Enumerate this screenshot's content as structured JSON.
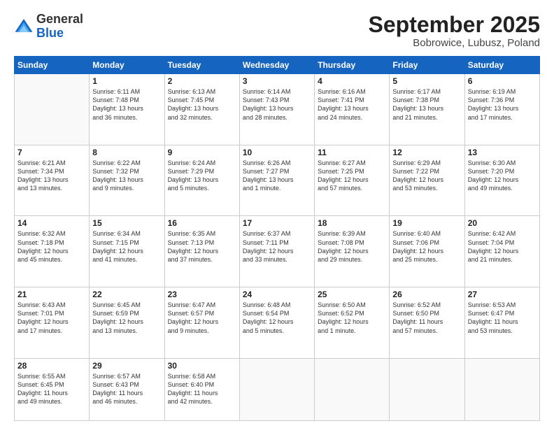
{
  "header": {
    "logo": {
      "general": "General",
      "blue": "Blue"
    },
    "title": "September 2025",
    "location": "Bobrowice, Lubusz, Poland"
  },
  "weekdays": [
    "Sunday",
    "Monday",
    "Tuesday",
    "Wednesday",
    "Thursday",
    "Friday",
    "Saturday"
  ],
  "weeks": [
    [
      {
        "day": "",
        "info": ""
      },
      {
        "day": "1",
        "info": "Sunrise: 6:11 AM\nSunset: 7:48 PM\nDaylight: 13 hours\nand 36 minutes."
      },
      {
        "day": "2",
        "info": "Sunrise: 6:13 AM\nSunset: 7:45 PM\nDaylight: 13 hours\nand 32 minutes."
      },
      {
        "day": "3",
        "info": "Sunrise: 6:14 AM\nSunset: 7:43 PM\nDaylight: 13 hours\nand 28 minutes."
      },
      {
        "day": "4",
        "info": "Sunrise: 6:16 AM\nSunset: 7:41 PM\nDaylight: 13 hours\nand 24 minutes."
      },
      {
        "day": "5",
        "info": "Sunrise: 6:17 AM\nSunset: 7:38 PM\nDaylight: 13 hours\nand 21 minutes."
      },
      {
        "day": "6",
        "info": "Sunrise: 6:19 AM\nSunset: 7:36 PM\nDaylight: 13 hours\nand 17 minutes."
      }
    ],
    [
      {
        "day": "7",
        "info": "Sunrise: 6:21 AM\nSunset: 7:34 PM\nDaylight: 13 hours\nand 13 minutes."
      },
      {
        "day": "8",
        "info": "Sunrise: 6:22 AM\nSunset: 7:32 PM\nDaylight: 13 hours\nand 9 minutes."
      },
      {
        "day": "9",
        "info": "Sunrise: 6:24 AM\nSunset: 7:29 PM\nDaylight: 13 hours\nand 5 minutes."
      },
      {
        "day": "10",
        "info": "Sunrise: 6:26 AM\nSunset: 7:27 PM\nDaylight: 13 hours\nand 1 minute."
      },
      {
        "day": "11",
        "info": "Sunrise: 6:27 AM\nSunset: 7:25 PM\nDaylight: 12 hours\nand 57 minutes."
      },
      {
        "day": "12",
        "info": "Sunrise: 6:29 AM\nSunset: 7:22 PM\nDaylight: 12 hours\nand 53 minutes."
      },
      {
        "day": "13",
        "info": "Sunrise: 6:30 AM\nSunset: 7:20 PM\nDaylight: 12 hours\nand 49 minutes."
      }
    ],
    [
      {
        "day": "14",
        "info": "Sunrise: 6:32 AM\nSunset: 7:18 PM\nDaylight: 12 hours\nand 45 minutes."
      },
      {
        "day": "15",
        "info": "Sunrise: 6:34 AM\nSunset: 7:15 PM\nDaylight: 12 hours\nand 41 minutes."
      },
      {
        "day": "16",
        "info": "Sunrise: 6:35 AM\nSunset: 7:13 PM\nDaylight: 12 hours\nand 37 minutes."
      },
      {
        "day": "17",
        "info": "Sunrise: 6:37 AM\nSunset: 7:11 PM\nDaylight: 12 hours\nand 33 minutes."
      },
      {
        "day": "18",
        "info": "Sunrise: 6:39 AM\nSunset: 7:08 PM\nDaylight: 12 hours\nand 29 minutes."
      },
      {
        "day": "19",
        "info": "Sunrise: 6:40 AM\nSunset: 7:06 PM\nDaylight: 12 hours\nand 25 minutes."
      },
      {
        "day": "20",
        "info": "Sunrise: 6:42 AM\nSunset: 7:04 PM\nDaylight: 12 hours\nand 21 minutes."
      }
    ],
    [
      {
        "day": "21",
        "info": "Sunrise: 6:43 AM\nSunset: 7:01 PM\nDaylight: 12 hours\nand 17 minutes."
      },
      {
        "day": "22",
        "info": "Sunrise: 6:45 AM\nSunset: 6:59 PM\nDaylight: 12 hours\nand 13 minutes."
      },
      {
        "day": "23",
        "info": "Sunrise: 6:47 AM\nSunset: 6:57 PM\nDaylight: 12 hours\nand 9 minutes."
      },
      {
        "day": "24",
        "info": "Sunrise: 6:48 AM\nSunset: 6:54 PM\nDaylight: 12 hours\nand 5 minutes."
      },
      {
        "day": "25",
        "info": "Sunrise: 6:50 AM\nSunset: 6:52 PM\nDaylight: 12 hours\nand 1 minute."
      },
      {
        "day": "26",
        "info": "Sunrise: 6:52 AM\nSunset: 6:50 PM\nDaylight: 11 hours\nand 57 minutes."
      },
      {
        "day": "27",
        "info": "Sunrise: 6:53 AM\nSunset: 6:47 PM\nDaylight: 11 hours\nand 53 minutes."
      }
    ],
    [
      {
        "day": "28",
        "info": "Sunrise: 6:55 AM\nSunset: 6:45 PM\nDaylight: 11 hours\nand 49 minutes."
      },
      {
        "day": "29",
        "info": "Sunrise: 6:57 AM\nSunset: 6:43 PM\nDaylight: 11 hours\nand 46 minutes."
      },
      {
        "day": "30",
        "info": "Sunrise: 6:58 AM\nSunset: 6:40 PM\nDaylight: 11 hours\nand 42 minutes."
      },
      {
        "day": "",
        "info": ""
      },
      {
        "day": "",
        "info": ""
      },
      {
        "day": "",
        "info": ""
      },
      {
        "day": "",
        "info": ""
      }
    ]
  ]
}
